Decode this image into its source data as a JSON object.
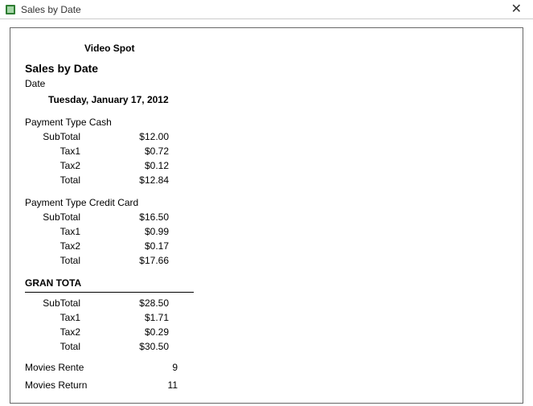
{
  "window": {
    "title": "Sales by Date"
  },
  "report": {
    "company": "Video Spot",
    "title": "Sales by Date",
    "date_label": "Date",
    "date_value": "Tuesday, January 17, 2012",
    "labels": {
      "payment_type_prefix": "Payment Type",
      "subtotal": "SubTotal",
      "tax1": "Tax1",
      "tax2": "Tax2",
      "total": "Total",
      "grand_total": "GRAN TOTA",
      "movies_rented": "Movies Rente",
      "movies_returned": "Movies Return"
    },
    "payment_types": [
      {
        "name": "Cash",
        "subtotal": "$12.00",
        "tax1": "$0.72",
        "tax2": "$0.12",
        "total": "$12.84"
      },
      {
        "name": "Credit Card",
        "subtotal": "$16.50",
        "tax1": "$0.99",
        "tax2": "$0.17",
        "total": "$17.66"
      }
    ],
    "grand_total": {
      "subtotal": "$28.50",
      "tax1": "$1.71",
      "tax2": "$0.29",
      "total": "$30.50"
    },
    "movies_rented": "9",
    "movies_returned": "11"
  }
}
